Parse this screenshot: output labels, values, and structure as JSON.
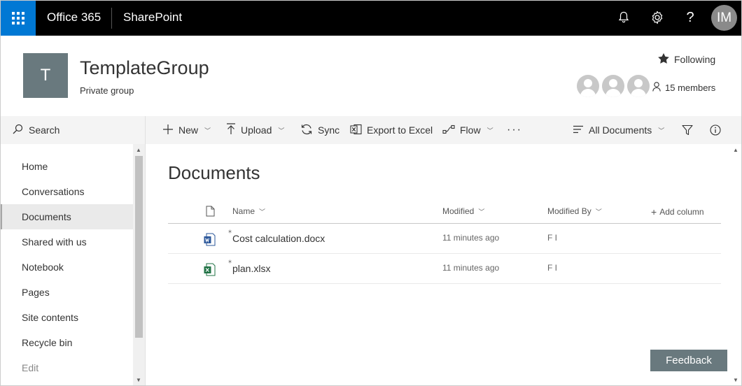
{
  "suitebar": {
    "brand": "Office 365",
    "app": "SharePoint",
    "avatar_initials": "IM"
  },
  "site": {
    "logo_letter": "T",
    "title": "TemplateGroup",
    "subtitle": "Private group",
    "following_label": "Following",
    "members_label": "15 members"
  },
  "search": {
    "label": "Search"
  },
  "nav": {
    "items": [
      {
        "label": "Home"
      },
      {
        "label": "Conversations"
      },
      {
        "label": "Documents"
      },
      {
        "label": "Shared with us"
      },
      {
        "label": "Notebook"
      },
      {
        "label": "Pages"
      },
      {
        "label": "Site contents"
      },
      {
        "label": "Recycle bin"
      },
      {
        "label": "Edit"
      }
    ],
    "selected": "Documents"
  },
  "commands": {
    "new": "New",
    "upload": "Upload",
    "sync": "Sync",
    "export": "Export to Excel",
    "flow": "Flow",
    "view": "All Documents"
  },
  "library": {
    "title": "Documents",
    "columns": {
      "name": "Name",
      "modified": "Modified",
      "modified_by": "Modified By",
      "add_column": "Add column"
    },
    "rows": [
      {
        "name": "Cost calculation.docx",
        "modified": "11 minutes ago",
        "modified_by": "F I",
        "type": "word"
      },
      {
        "name": "plan.xlsx",
        "modified": "11 minutes ago",
        "modified_by": "F I",
        "type": "excel"
      }
    ]
  },
  "feedback_label": "Feedback",
  "colors": {
    "accent": "#0078d4",
    "suitebar": "#000000",
    "site_logo": "#69797e",
    "word": "#2b579a",
    "excel": "#217346"
  }
}
